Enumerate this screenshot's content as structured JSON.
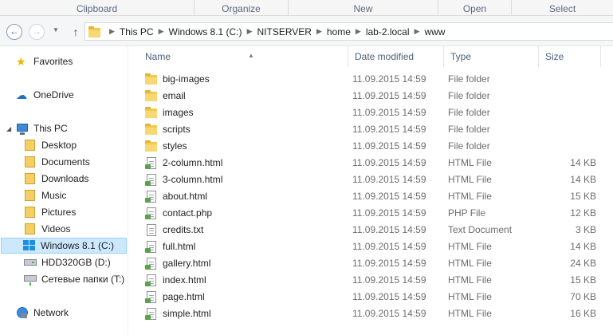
{
  "ribbon": {
    "groups": [
      "Clipboard",
      "Organize",
      "New",
      "Open",
      "Select"
    ]
  },
  "address": {
    "crumbs": [
      "This PC",
      "Windows 8.1 (C:)",
      "NITSERVER",
      "home",
      "lab-2.local",
      "www"
    ]
  },
  "nav": {
    "favorites": "Favorites",
    "onedrive": "OneDrive",
    "thispc": "This PC",
    "desktop": "Desktop",
    "documents": "Documents",
    "downloads": "Downloads",
    "music": "Music",
    "pictures": "Pictures",
    "videos": "Videos",
    "drive_c": "Windows 8.1 (C:)",
    "drive_d": "HDD320GB (D:)",
    "netdrive": "Сетевые папки (T:)",
    "network": "Network"
  },
  "columns": {
    "name": "Name",
    "date": "Date modified",
    "type": "Type",
    "size": "Size"
  },
  "files": [
    {
      "name": "big-images",
      "date": "11.09.2015 14:59",
      "type": "File folder",
      "size": "",
      "icon": "folder-icon"
    },
    {
      "name": "email",
      "date": "11.09.2015 14:59",
      "type": "File folder",
      "size": "",
      "icon": "folder-icon"
    },
    {
      "name": "images",
      "date": "11.09.2015 14:59",
      "type": "File folder",
      "size": "",
      "icon": "folder-icon"
    },
    {
      "name": "scripts",
      "date": "11.09.2015 14:59",
      "type": "File folder",
      "size": "",
      "icon": "folder-icon"
    },
    {
      "name": "styles",
      "date": "11.09.2015 14:59",
      "type": "File folder",
      "size": "",
      "icon": "folder-icon"
    },
    {
      "name": "2-column.html",
      "date": "11.09.2015 14:59",
      "type": "HTML File",
      "size": "14 KB",
      "icon": "html-file-icon"
    },
    {
      "name": "3-column.html",
      "date": "11.09.2015 14:59",
      "type": "HTML File",
      "size": "14 KB",
      "icon": "html-file-icon"
    },
    {
      "name": "about.html",
      "date": "11.09.2015 14:59",
      "type": "HTML File",
      "size": "15 KB",
      "icon": "html-file-icon"
    },
    {
      "name": "contact.php",
      "date": "11.09.2015 14:59",
      "type": "PHP File",
      "size": "12 KB",
      "icon": "php-file-icon"
    },
    {
      "name": "credits.txt",
      "date": "11.09.2015 14:59",
      "type": "Text Document",
      "size": "3 KB",
      "icon": "text-file-icon"
    },
    {
      "name": "full.html",
      "date": "11.09.2015 14:59",
      "type": "HTML File",
      "size": "14 KB",
      "icon": "html-file-icon"
    },
    {
      "name": "gallery.html",
      "date": "11.09.2015 14:59",
      "type": "HTML File",
      "size": "24 KB",
      "icon": "html-file-icon"
    },
    {
      "name": "index.html",
      "date": "11.09.2015 14:59",
      "type": "HTML File",
      "size": "15 KB",
      "icon": "html-file-icon"
    },
    {
      "name": "page.html",
      "date": "11.09.2015 14:59",
      "type": "HTML File",
      "size": "70 KB",
      "icon": "html-file-icon"
    },
    {
      "name": "simple.html",
      "date": "11.09.2015 14:59",
      "type": "HTML File",
      "size": "16 KB",
      "icon": "html-file-icon"
    }
  ]
}
